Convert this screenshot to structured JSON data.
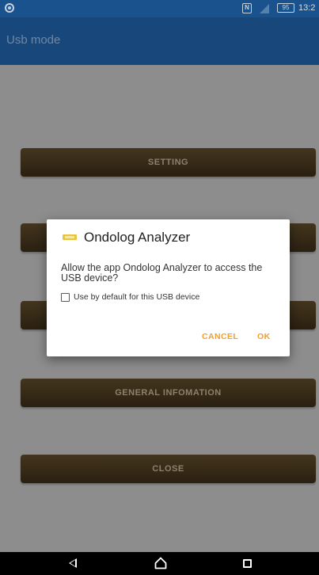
{
  "status_bar": {
    "time": "13:2",
    "battery": "95",
    "nfc": "N"
  },
  "app_bar": {
    "title": "Usb mode"
  },
  "main": {
    "buttons": [
      {
        "label": "SETTING"
      },
      {
        "label": ""
      },
      {
        "label": ""
      },
      {
        "label": "GENERAL INFOMATION"
      },
      {
        "label": "CLOSE"
      }
    ]
  },
  "dialog": {
    "title": "Ondolog Analyzer",
    "message": "Allow the app Ondolog Analyzer to access the USB device?",
    "checkbox_label": "Use by default for this USB device",
    "checkbox_checked": false,
    "cancel_label": "CANCEL",
    "ok_label": "OK",
    "accent_color": "#f0a030",
    "icon": "usb-device-icon"
  },
  "nav_bar": {
    "back_icon": "back-icon",
    "home_icon": "home-icon",
    "recents_icon": "recents-icon"
  }
}
